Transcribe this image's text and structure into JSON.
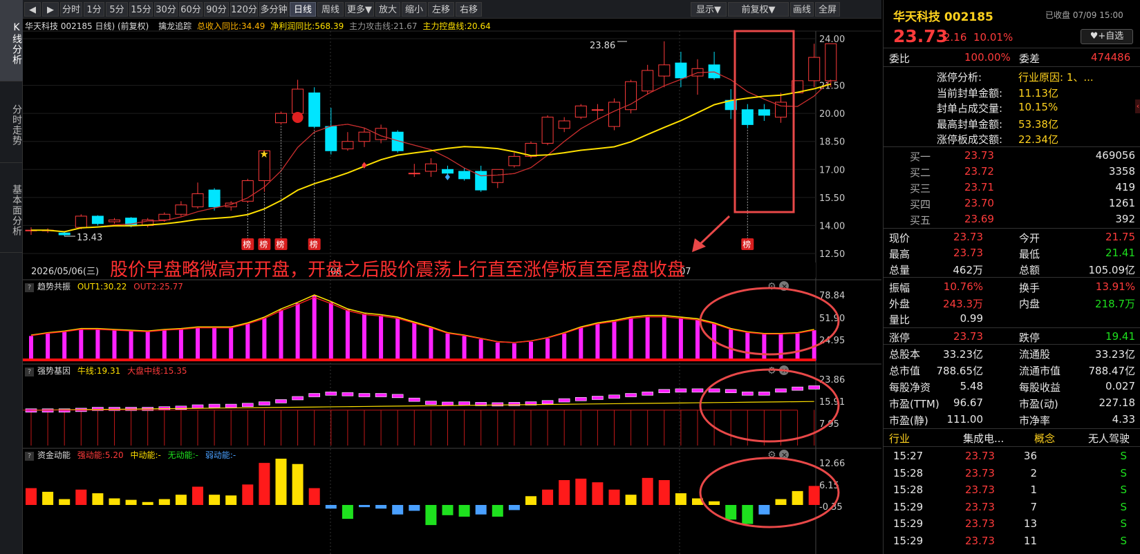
{
  "nav": {
    "tabs": [
      "K线分析",
      "分时走势",
      "基本面分析"
    ]
  },
  "toolbar": {
    "left": [
      "◀",
      "▶",
      "分时",
      "1分",
      "5分",
      "15分",
      "30分",
      "60分",
      "90分",
      "120分",
      "多分钟",
      "日线",
      "周线",
      "更多▼",
      "放大",
      "缩小",
      "左移",
      "右移"
    ],
    "right": [
      "显示▼",
      "前复权▼",
      "画线",
      "全屏"
    ]
  },
  "chart": {
    "header": {
      "name": "华天科技 002185 日线)",
      "adjust": "(前复权)",
      "indicator": "擒龙追踪",
      "i1": "总收入同比:34.49",
      "i2": "净利润同比:568.39",
      "i3": "主力攻击线:21.67",
      "i4": "主力控盘线:20.64"
    },
    "price_ticks": [
      "24.00",
      "21.50",
      "20.00",
      "18.50",
      "17.00",
      "15.50",
      "14.00",
      "12.50"
    ],
    "high_label": "23.86",
    "low_label": "13.43",
    "bang": "榜",
    "date_label": "2026/05/06(三)",
    "month1": "06",
    "month2": "07",
    "annotation": "股价早盘略微高开开盘，开盘之后股价震荡上行直至涨停板直至尾盘收盘"
  },
  "panel1": {
    "title": "趋势共振",
    "out1": "OUT1:30.22",
    "out2": "OUT2:25.77",
    "ticks": [
      "78.84",
      "51.90",
      "24.95"
    ]
  },
  "panel2": {
    "title": "强势基因",
    "l1": "牛线:19.31",
    "l2": "大盘中线:15.35",
    "ticks": [
      "23.86",
      "15.91",
      "7.95"
    ]
  },
  "panel3": {
    "title": "资金动能",
    "l1": "强动能:5.20",
    "l2": "中动能:-",
    "l3": "无动能:-",
    "l4": "弱动能:-",
    "ticks": [
      "12.66",
      "6.15",
      "-0.35"
    ]
  },
  "chart_data": [
    {
      "type": "candlestick",
      "title": "华天科技 002185 日线",
      "ylim": [
        12.5,
        24.0
      ],
      "ohlc": [
        [
          13.75,
          13.75,
          13.5,
          13.9
        ],
        [
          13.75,
          13.75,
          13.6,
          13.85
        ],
        [
          13.6,
          13.5,
          13.43,
          13.65
        ],
        [
          13.9,
          14.5,
          13.8,
          14.6
        ],
        [
          14.5,
          14.1,
          14.0,
          14.55
        ],
        [
          14.2,
          14.3,
          14.1,
          14.4
        ],
        [
          14.4,
          14.0,
          13.9,
          14.45
        ],
        [
          14.0,
          14.3,
          13.9,
          14.4
        ],
        [
          14.3,
          14.6,
          14.2,
          14.7
        ],
        [
          14.6,
          15.1,
          14.5,
          15.3
        ],
        [
          15.0,
          15.7,
          14.9,
          16.3
        ],
        [
          15.9,
          15.0,
          14.8,
          16.0
        ],
        [
          15.0,
          15.2,
          14.8,
          15.3
        ],
        [
          15.3,
          16.4,
          15.2,
          16.5
        ],
        [
          16.4,
          18.0,
          15.8,
          18.0
        ],
        [
          19.5,
          20.0,
          19.4,
          20.1
        ],
        [
          20.0,
          21.3,
          19.9,
          21.8
        ],
        [
          21.1,
          19.3,
          19.2,
          21.4
        ],
        [
          19.3,
          18.0,
          17.8,
          20.3
        ],
        [
          18.1,
          18.5,
          18.0,
          19.0
        ],
        [
          18.5,
          19.0,
          18.2,
          19.2
        ],
        [
          18.6,
          19.2,
          18.4,
          19.4
        ],
        [
          19.0,
          18.0,
          17.9,
          19.1
        ],
        [
          16.8,
          16.8,
          16.6,
          17.3
        ],
        [
          16.9,
          17.3,
          16.6,
          17.6
        ],
        [
          17.0,
          16.8,
          16.6,
          17.2
        ],
        [
          16.9,
          16.5,
          16.4,
          17.1
        ],
        [
          16.9,
          15.9,
          15.8,
          17.2
        ],
        [
          16.3,
          17.0,
          16.0,
          17.0
        ],
        [
          17.2,
          17.7,
          17.1,
          17.9
        ],
        [
          17.7,
          18.4,
          17.6,
          18.5
        ],
        [
          18.4,
          19.8,
          18.3,
          19.9
        ],
        [
          19.2,
          19.6,
          19.0,
          19.8
        ],
        [
          19.8,
          20.4,
          19.7,
          20.5
        ],
        [
          20.2,
          20.2,
          19.7,
          20.5
        ],
        [
          19.3,
          20.6,
          19.1,
          20.8
        ],
        [
          20.2,
          21.7,
          20.0,
          21.8
        ],
        [
          21.2,
          22.3,
          21.0,
          22.6
        ],
        [
          22.0,
          22.6,
          21.4,
          23.86
        ],
        [
          22.7,
          21.9,
          21.4,
          23.3
        ],
        [
          22.0,
          22.4,
          21.0,
          22.9
        ],
        [
          22.6,
          21.9,
          21.8,
          23.3
        ],
        [
          20.7,
          20.2,
          19.7,
          21.3
        ],
        [
          20.2,
          19.4,
          19.2,
          20.5
        ],
        [
          20.2,
          19.9,
          19.6,
          20.5
        ],
        [
          19.8,
          20.6,
          19.5,
          21.1
        ],
        [
          21.1,
          21.75,
          21.4,
          21.75
        ],
        [
          21.75,
          23.0,
          21.41,
          23.73
        ],
        [
          21.75,
          23.73,
          21.41,
          23.73
        ]
      ]
    },
    {
      "type": "bar",
      "title": "趋势共振",
      "series": [
        {
          "name": "OUT1",
          "values": [
            30.22
          ]
        },
        {
          "name": "OUT2",
          "values": [
            25.77
          ]
        }
      ]
    },
    {
      "type": "bar",
      "title": "强势基因",
      "series": [
        {
          "name": "牛线",
          "values": [
            19.31
          ]
        },
        {
          "name": "大盘中线",
          "values": [
            15.35
          ]
        }
      ]
    },
    {
      "type": "bar",
      "title": "资金动能",
      "series": [
        {
          "name": "强动能",
          "values": [
            5.2
          ]
        }
      ]
    }
  ],
  "quote": {
    "name": "华天科技 002185",
    "status": "已收盘 07/09 15:00",
    "price": "23.73",
    "chg": "2.16",
    "pct": "10.01%",
    "watch": "+自选",
    "wb_label": "委比",
    "wb": "100.00%",
    "wc_label": "委差",
    "wc": "474486",
    "limit_info": [
      [
        "涨停分析:",
        "行业原因: 1、..."
      ],
      [
        "当前封单金额:",
        "11.13亿"
      ],
      [
        "封单占成交量:",
        "10.15%"
      ],
      [
        "最高封单金额:",
        "53.38亿"
      ],
      [
        "涨停板成交额:",
        "22.34亿"
      ]
    ],
    "bids": [
      [
        "买一",
        "23.73",
        "469056"
      ],
      [
        "买二",
        "23.72",
        "3358"
      ],
      [
        "买三",
        "23.71",
        "419"
      ],
      [
        "买四",
        "23.70",
        "1261"
      ],
      [
        "买五",
        "23.69",
        "392"
      ]
    ],
    "stats": [
      [
        "现价",
        "23.73",
        "今开",
        "21.75"
      ],
      [
        "最高",
        "23.73",
        "最低",
        "21.41"
      ],
      [
        "总量",
        "462万",
        "总额",
        "105.09亿"
      ]
    ],
    "stats2": [
      [
        "振幅",
        "10.76%",
        "换手",
        "13.91%"
      ],
      [
        "外盘",
        "243.3万",
        "内盘",
        "218.7万"
      ],
      [
        "量比",
        "0.99",
        "",
        ""
      ]
    ],
    "stats3": [
      [
        "涨停",
        "23.73",
        "跌停",
        "19.41"
      ]
    ],
    "fund": [
      [
        "总股本",
        "33.23亿",
        "流通股",
        "33.23亿"
      ],
      [
        "总市值",
        "788.65亿",
        "流通市值",
        "788.47亿"
      ],
      [
        "每股净资",
        "5.48",
        "每股收益",
        "0.027"
      ],
      [
        "市盈(TTM)",
        "96.67",
        "市盈(动)",
        "227.18"
      ],
      [
        "市盈(静)",
        "111.00",
        "市净率",
        "4.33"
      ]
    ],
    "industry": [
      "行业",
      "集成电...",
      "概念",
      "无人驾驶"
    ],
    "ticks": [
      [
        "15:27",
        "23.73",
        "36",
        "S"
      ],
      [
        "15:28",
        "23.73",
        "2",
        "S"
      ],
      [
        "15:28",
        "23.73",
        "1",
        "S"
      ],
      [
        "15:29",
        "23.73",
        "7",
        "S"
      ],
      [
        "15:29",
        "23.73",
        "13",
        "S"
      ],
      [
        "15:29",
        "23.73",
        "11",
        "S"
      ]
    ]
  }
}
